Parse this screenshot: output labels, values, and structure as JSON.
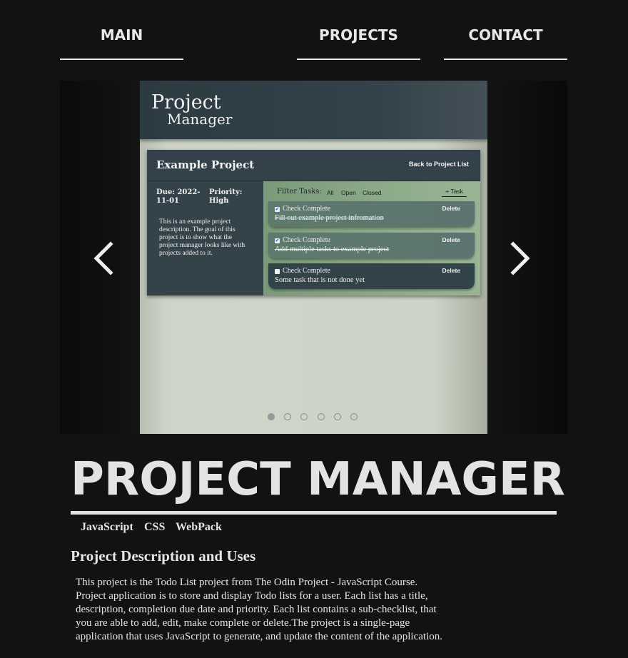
{
  "nav": {
    "main": "MAIN",
    "projects": "PROJECTS",
    "contact": "CONTACT"
  },
  "carousel": {
    "slide": {
      "app_title_line1": "Project",
      "app_title_line2": "Manager",
      "project_name": "Example Project",
      "back_link": "Back to Project List",
      "due": "Due: 2022-11-01",
      "priority": "Priority: High",
      "description": "This is an example project description. The goal of this project is to show what the project manager looks like with projects added to it.",
      "filter_label": "Filter Tasks:",
      "filters": [
        "All",
        "Open",
        "Closed"
      ],
      "add_task": "+ Task",
      "tasks": [
        {
          "status": "Check Complete",
          "text": "Fill out example project infromation",
          "delete": "Delete",
          "done": true
        },
        {
          "status": "Check Complete",
          "text": "Add multiple tasks to example project",
          "delete": "Delete",
          "done": true
        },
        {
          "status": "Check Complete",
          "text": "Some task that is not done yet",
          "delete": "Delete",
          "done": false
        }
      ]
    },
    "total_slides": 6,
    "active_slide": 1
  },
  "project": {
    "title": "PROJECT MANAGER",
    "tags": [
      "JavaScript",
      "CSS",
      "WebPack"
    ],
    "section_heading": "Project Description and Uses",
    "section_body": "This project is the Todo List project from The Odin Project - JavaScript Course. Project application is to store and display Todo lists for a user. Each list has a title, description, completion due date and priority. Each list contains a sub-checklist, that you are able to add, edit, make complete or delete.The project is a single-page application that uses JavaScript to generate, and update the content of the application."
  },
  "colors": {
    "background": "#121212",
    "text": "#e6e6e6",
    "app_header": "#2c3a42",
    "task_panel": "#8eab8a"
  },
  "icons": {
    "prev": "chevron-left-icon",
    "next": "chevron-right-icon"
  }
}
